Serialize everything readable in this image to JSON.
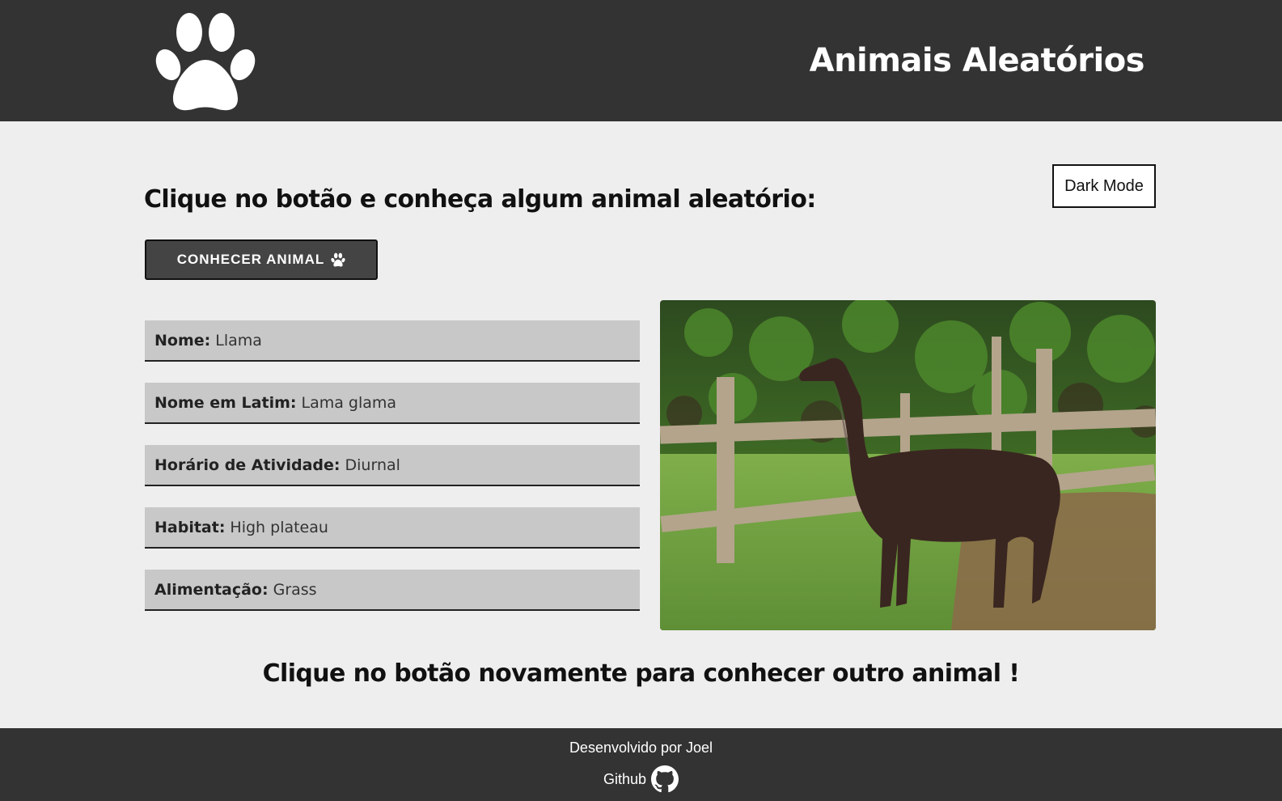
{
  "header": {
    "logo_icon": "paw-icon",
    "title": "Animais Aleatórios"
  },
  "main": {
    "dark_mode_label": "Dark Mode",
    "prompt": "Clique no botão e conheça algum animal aleatório:",
    "know_animal_label": "CONHECER ANIMAL",
    "know_animal_icon": "paw-icon",
    "info": [
      {
        "label": "Nome:",
        "value": "Llama"
      },
      {
        "label": "Nome em Latim:",
        "value": "Lama glama"
      },
      {
        "label": "Horário de Atividade:",
        "value": "Diurnal"
      },
      {
        "label": "Habitat:",
        "value": "High plateau"
      },
      {
        "label": "Alimentação:",
        "value": "Grass"
      }
    ],
    "again_prompt": "Clique no botão novamente para conhecer outro animal !"
  },
  "footer": {
    "credit": "Desenvolvido por Joel",
    "github_label": "Github",
    "github_icon": "github-icon"
  },
  "colors": {
    "header_bg": "#333333",
    "page_bg": "#eeeeee",
    "info_bg": "#c8c8c8",
    "button_bg": "#444444"
  }
}
